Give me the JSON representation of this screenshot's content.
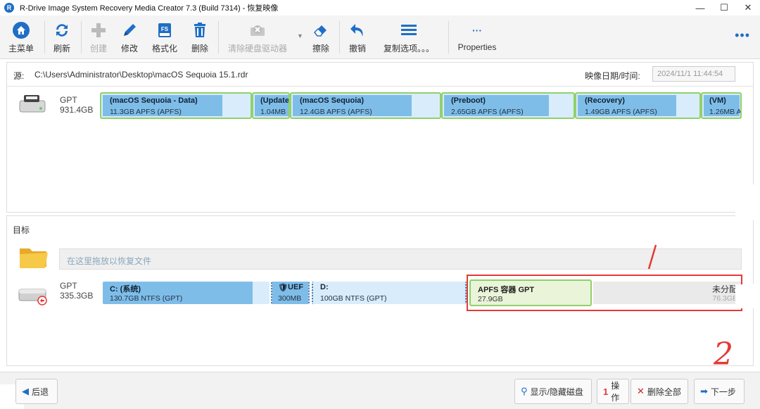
{
  "window": {
    "title": "R-Drive Image System Recovery Media Creator 7.3 (Build 7314) - 恢复映像",
    "app_icon_letter": "R",
    "minimize": "—",
    "maximize": "☐",
    "close": "✕"
  },
  "toolbar": {
    "items": [
      {
        "label": "主菜单",
        "icon": "home-icon",
        "enabled": true
      },
      {
        "label": "刷新",
        "icon": "refresh-icon",
        "enabled": true
      },
      {
        "label": "创建",
        "icon": "plus-icon",
        "enabled": false
      },
      {
        "label": "修改",
        "icon": "pencil-icon",
        "enabled": true
      },
      {
        "label": "格式化",
        "icon": "format-icon",
        "enabled": true
      },
      {
        "label": "删除",
        "icon": "trash-icon",
        "enabled": true
      },
      {
        "label": "清除硬盘驱动器",
        "icon": "wipe-drive-icon",
        "enabled": false
      },
      {
        "label": "擦除",
        "icon": "eraser-icon",
        "enabled": true
      },
      {
        "label": "撤销",
        "icon": "undo-icon",
        "enabled": true
      },
      {
        "label": "复制选项。。。",
        "icon": "menu-icon",
        "enabled": true
      },
      {
        "label": "Properties",
        "icon": "ellipsis-icon",
        "enabled": true
      }
    ],
    "more": "•••",
    "format_badge": "FS"
  },
  "source": {
    "label": "源:",
    "path": "C:\\Users\\Administrator\\Desktop\\macOS Sequoia 15.1.rdr",
    "date_label": "映像日期/时间:",
    "date_value": "2024/11/1 11:44:54",
    "disk": {
      "type": "GPT",
      "size": "931.4GB",
      "partitions": [
        {
          "name": "(macOS Sequoia - Data)",
          "size": "11.3GB APFS (APFS)",
          "fill": 0.8
        },
        {
          "name": "(Update",
          "size": "1.04MB",
          "fill": 0.95
        },
        {
          "name": "(macOS Sequoia)",
          "size": "12.4GB APFS (APFS)",
          "fill": 0.8
        },
        {
          "name": "(Preboot)",
          "size": "2.65GB APFS (APFS)",
          "fill": 0.8
        },
        {
          "name": "(Recovery)",
          "size": "1.49GB APFS (APFS)",
          "fill": 0.8
        },
        {
          "name": "(VM)",
          "size": "1.26MB A",
          "fill": 0.95
        }
      ]
    }
  },
  "target": {
    "title": "目标",
    "drop_hint": "在这里拖放以恢复文件",
    "disk": {
      "type": "GPT",
      "size": "335.3GB",
      "partitions": [
        {
          "name": "C: (系统)",
          "size": "130.7GB NTFS (GPT)",
          "fill": 0.9
        },
        {
          "name": "UEF",
          "size": "300MB",
          "fill": 1.0
        },
        {
          "name": "D:",
          "size": "100GB NTFS (GPT)",
          "fill": 0.0
        }
      ],
      "apfs": {
        "name": "APFS 容器 GPT",
        "size": "27.9GB"
      },
      "unallocated": {
        "name": "未分配",
        "size": "76.3GB"
      }
    }
  },
  "annotations": {
    "mark1": "1",
    "mark2": "2"
  },
  "bottom": {
    "back": "后退",
    "show_hide": "显示/隐藏磁盘",
    "ops_count": "1",
    "ops": "操作",
    "delete_all": "删除全部",
    "next": "下一步"
  },
  "colors": {
    "accent": "#1f6fc5",
    "partition_fill": "#7fbde9",
    "partition_bg": "#d9ecfb",
    "partition_border": "#8fd16a",
    "annotation_red": "#e53935"
  }
}
